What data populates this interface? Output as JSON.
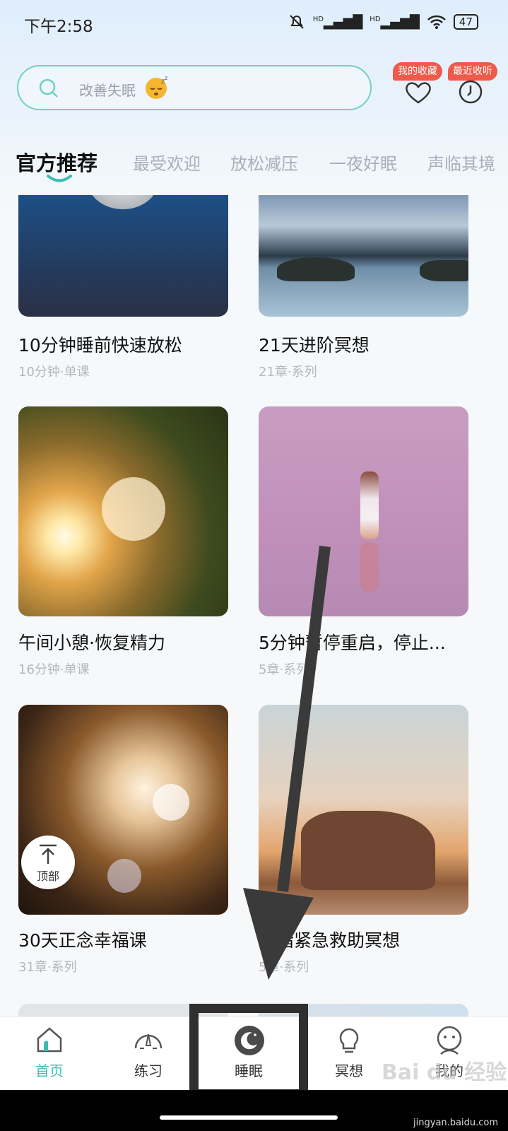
{
  "status": {
    "time": "下午2:58",
    "net1": "HD",
    "net2": "HD",
    "battery": "47"
  },
  "search": {
    "placeholder": "改善失眠"
  },
  "badges": {
    "favorites": "我的收藏",
    "recent": "最近收听"
  },
  "tabs": [
    "官方推荐",
    "最受欢迎",
    "放松减压",
    "一夜好眠",
    "声临其境"
  ],
  "cards": [
    {
      "title": "10分钟睡前快速放松",
      "sub": "10分钟·单课"
    },
    {
      "title": "21天进阶冥想",
      "sub": "21章·系列"
    },
    {
      "title": "午间小憩·恢复精力",
      "sub": "16分钟·单课"
    },
    {
      "title": "5分钟暂停重启，停止...",
      "sub": "5章·系列"
    },
    {
      "title": "30天正念幸福课",
      "sub": "31章·系列"
    },
    {
      "title": "情绪紧急救助冥想",
      "sub": "5章·系列"
    }
  ],
  "to_top": "顶部",
  "nav": [
    {
      "label": "首页",
      "icon": "home-icon"
    },
    {
      "label": "练习",
      "icon": "gauge-icon"
    },
    {
      "label": "睡眠",
      "icon": "moon-icon"
    },
    {
      "label": "冥想",
      "icon": "bulb-icon"
    },
    {
      "label": "我的",
      "icon": "profile-icon"
    }
  ],
  "watermark": {
    "logo": "Bai du 经验",
    "url": "jingyan.baidu.com"
  },
  "colors": {
    "accent": "#3fbcb0",
    "badge": "#ef5a4b",
    "search_border": "#6fd1c2"
  }
}
